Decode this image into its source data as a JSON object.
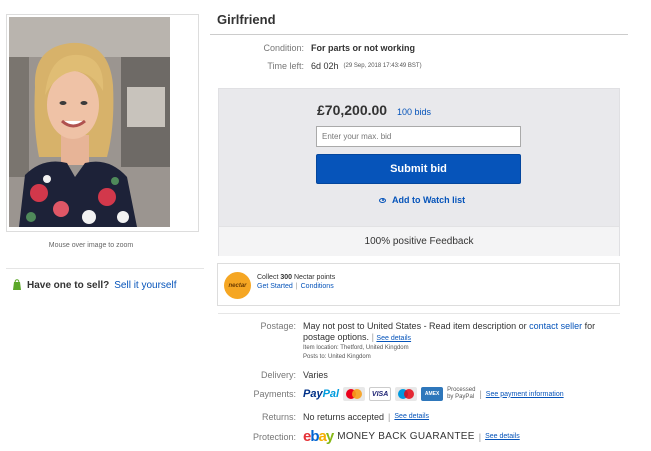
{
  "item": {
    "title": "Girlfriend",
    "condition_label": "Condition:",
    "condition_value": "For parts or not working",
    "time_left_label": "Time left:",
    "time_left_value": "6d 02h",
    "time_left_detail": "(29 Sep, 2018   17:43:49 BST)"
  },
  "gallery": {
    "zoom_note": "Mouse over image to zoom"
  },
  "sell": {
    "question": "Have one to sell?",
    "link": "Sell it yourself"
  },
  "bidding": {
    "price": "£70,200.00",
    "bids": "100 bids",
    "input_placeholder": "Enter your max. bid",
    "submit_label": "Submit bid",
    "watch_label": "Add to Watch list",
    "feedback": "100% positive Feedback"
  },
  "nectar": {
    "logo_text": "nectar",
    "collect_prefix": "Collect",
    "points": "300",
    "collect_suffix": "Nectar points",
    "get_started": "Get Started",
    "separator": "|",
    "conditions": "Conditions"
  },
  "shipping": {
    "postage_label": "Postage:",
    "postage_text_1": "May not post to United States - Read item description or",
    "contact_seller": "contact seller",
    "postage_text_2": "for postage options.",
    "see_details": "See details",
    "item_location": "Item location:  Thetford, United Kingdom",
    "posts_to": "Posts to:  United Kingdom",
    "delivery_label": "Delivery:",
    "delivery_value": "Varies",
    "payments_label": "Payments:",
    "paypal_1": "Pay",
    "paypal_2": "Pal",
    "visa": "VISA",
    "amex": "AMEX",
    "processed_1": "Processed",
    "processed_2": "by PayPal",
    "see_payment_info": "See payment information",
    "returns_label": "Returns:",
    "returns_value": "No returns accepted",
    "protection_label": "Protection:",
    "ebay_e": "e",
    "ebay_b": "b",
    "ebay_a": "a",
    "ebay_y": "y",
    "money_back": "MONEY BACK GUARANTEE"
  }
}
